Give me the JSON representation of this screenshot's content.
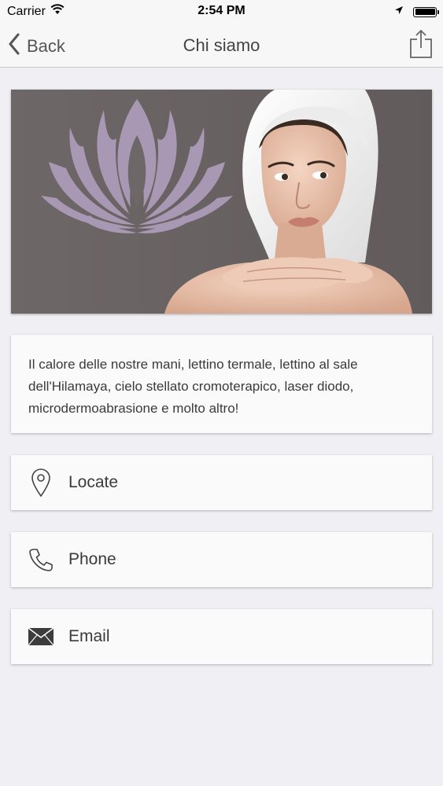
{
  "status_bar": {
    "carrier": "Carrier",
    "time": "2:54 PM"
  },
  "nav": {
    "back_label": "Back",
    "title": "Chi siamo"
  },
  "about": {
    "description": "Il calore delle nostre mani, lettino termale, lettino al sale dell'Hilamaya, cielo stellato cromoterapico, laser diodo, microdermoabrasione e molto altro!"
  },
  "actions": [
    {
      "label": "Locate",
      "icon": "map-pin-icon"
    },
    {
      "label": "Phone",
      "icon": "phone-icon"
    },
    {
      "label": "Email",
      "icon": "envelope-icon"
    }
  ],
  "colors": {
    "hero_background": "#6f6767",
    "lotus": "#a898b4",
    "page_background": "#efeff4"
  }
}
